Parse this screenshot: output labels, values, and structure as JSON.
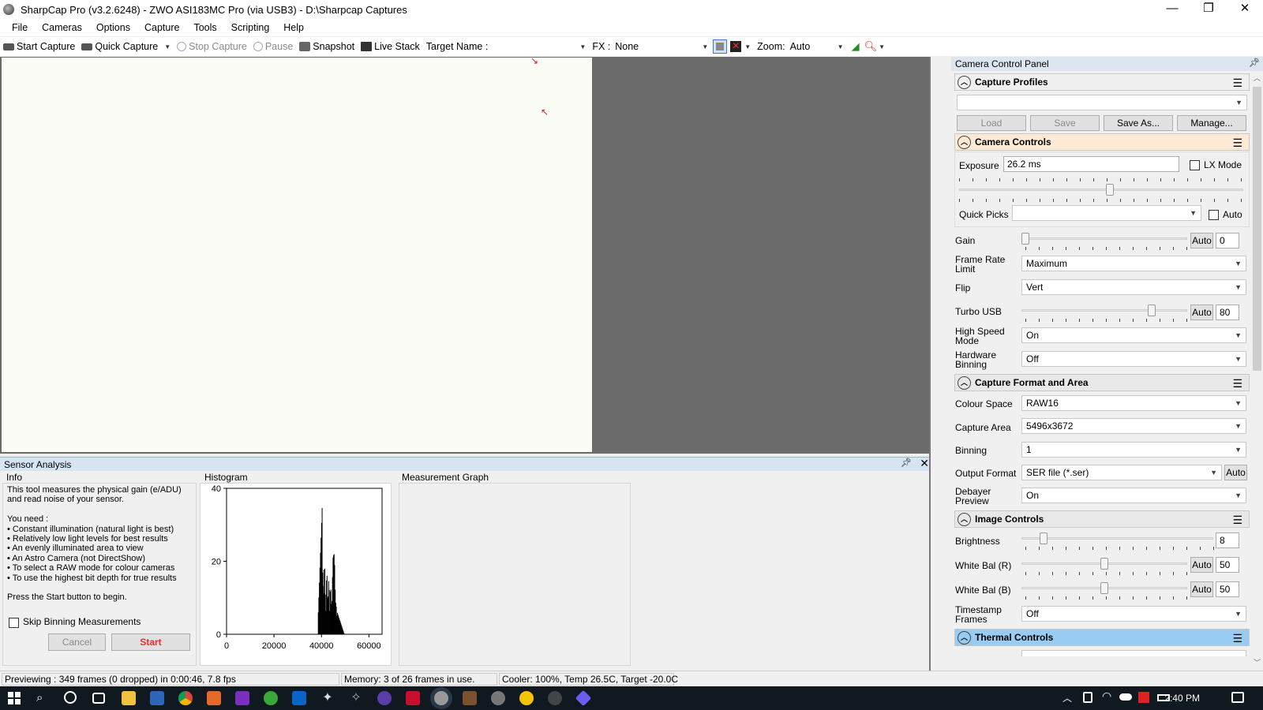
{
  "window": {
    "title": "SharpCap Pro (v3.2.6248) - ZWO ASI183MC Pro (via USB3) - D:\\Sharpcap Captures",
    "controls": {
      "minimize": "—",
      "maximize": "❐",
      "close": "✕"
    }
  },
  "menu": [
    "File",
    "Cameras",
    "Options",
    "Capture",
    "Tools",
    "Scripting",
    "Help"
  ],
  "toolbar": {
    "start_capture": "Start Capture",
    "quick_capture": "Quick Capture",
    "stop_capture": "Stop Capture",
    "pause": "Pause",
    "snapshot": "Snapshot",
    "live_stack": "Live Stack",
    "target_name_label": "Target Name :",
    "target_name_value": "",
    "fx_label": "FX :",
    "fx_value": "None",
    "zoom_label": "Zoom:",
    "zoom_value": "Auto"
  },
  "sensor_analysis": {
    "title": "Sensor Analysis",
    "info_title": "Info",
    "info_lines": [
      "This tool measures the physical gain (e/ADU)",
      "and read noise of your sensor.",
      "",
      "You need :",
      "• Constant illumination (natural light is best)",
      "• Relatively low light levels for best results",
      "• An evenly illuminated area to view",
      "• An Astro Camera (not DirectShow)",
      "• To select a RAW mode for colour cameras",
      "• To use the highest bit depth for true results",
      "",
      "Press the Start button to begin."
    ],
    "skip_binning_label": "Skip Binning Measurements",
    "skip_binning_checked": false,
    "cancel_label": "Cancel",
    "start_label": "Start",
    "histogram_title": "Histogram",
    "histogram": {
      "y_ticks": [
        "40",
        "20",
        "0"
      ],
      "x_ticks": [
        "0",
        "20000",
        "40000",
        "60000"
      ],
      "xlim": [
        0,
        65535
      ],
      "ylim": [
        0,
        40
      ]
    },
    "measurement_graph_title": "Measurement Graph"
  },
  "status": {
    "preview": "Previewing : 349 frames (0 dropped) in 0:00:46, 7.8 fps",
    "memory": "Memory: 3 of 26 frames in use.",
    "cooler": "Cooler: 100%, Temp 26.5C, Target -20.0C"
  },
  "camera_control_panel": {
    "title": "Camera Control Panel",
    "capture_profiles": {
      "title": "Capture Profiles",
      "profile_value": "",
      "load": "Load",
      "save": "Save",
      "save_as": "Save As...",
      "manage": "Manage..."
    },
    "camera_controls": {
      "title": "Camera Controls",
      "exposure_label": "Exposure",
      "exposure_value": "26.2 ms",
      "lx_mode_label": "LX Mode",
      "exposure_level": 0.53,
      "quick_picks_label": "Quick Picks",
      "quick_picks_value": "",
      "auto_label": "Auto",
      "gain_label": "Gain",
      "gain_auto": "Auto",
      "gain_value": "0",
      "gain_level": 0.0,
      "frame_rate_label_1": "Frame Rate",
      "frame_rate_label_2": "Limit",
      "frame_rate_value": "Maximum",
      "flip_label": "Flip",
      "flip_value": "Vert",
      "turbo_usb_label": "Turbo USB",
      "turbo_auto": "Auto",
      "turbo_value": "80",
      "turbo_level": 0.8,
      "high_speed_label_1": "High Speed",
      "high_speed_label_2": "Mode",
      "high_speed_value": "On",
      "hw_binning_label_1": "Hardware",
      "hw_binning_label_2": "Binning",
      "hw_binning_value": "Off"
    },
    "capture_format": {
      "title": "Capture Format and Area",
      "colour_space_label": "Colour Space",
      "colour_space_value": "RAW16",
      "capture_area_label": "Capture Area",
      "capture_area_value": "5496x3672",
      "binning_label": "Binning",
      "binning_value": "1",
      "output_format_label": "Output Format",
      "output_format_value": "SER file (*.ser)",
      "output_auto": "Auto",
      "debayer_label_1": "Debayer",
      "debayer_label_2": "Preview",
      "debayer_value": "On"
    },
    "image_controls": {
      "title": "Image Controls",
      "brightness_label": "Brightness",
      "brightness_value": "8",
      "brightness_level": 0.1,
      "wb_r_label": "White Bal (R)",
      "wb_r_auto": "Auto",
      "wb_r_value": "50",
      "wb_r_level": 0.5,
      "wb_b_label": "White Bal (B)",
      "wb_b_auto": "Auto",
      "wb_b_value": "50",
      "wb_b_level": 0.5,
      "timestamp_label_1": "Timestamp",
      "timestamp_label_2": "Frames",
      "timestamp_value": "Off"
    },
    "thermal_controls": {
      "title": "Thermal Controls"
    }
  },
  "taskbar": {
    "clock": "2:40 PM"
  },
  "colors": {
    "camera_controls_header": "#fde9d4",
    "thermal_controls_header": "#99ccf3",
    "start_button": "#e62e2e"
  }
}
